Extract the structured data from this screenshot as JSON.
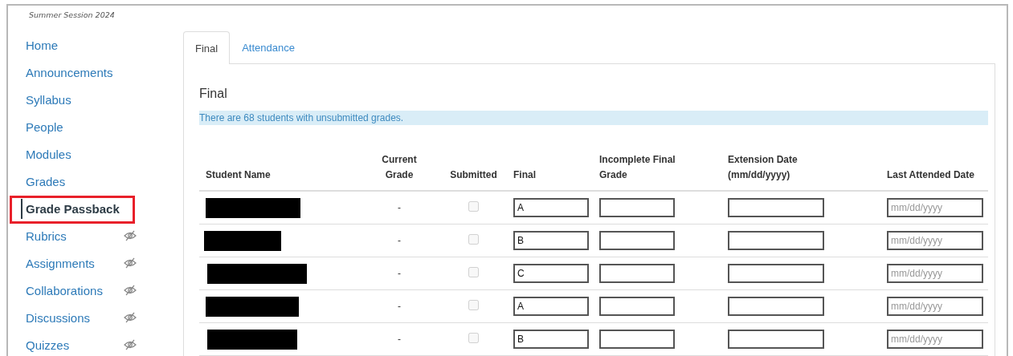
{
  "course": {
    "term": "Summer Session 2024"
  },
  "sidebar": {
    "items": [
      {
        "label": "Home",
        "selected": false,
        "hidden": false,
        "outlined": false
      },
      {
        "label": "Announcements",
        "selected": false,
        "hidden": false,
        "outlined": false
      },
      {
        "label": "Syllabus",
        "selected": false,
        "hidden": false,
        "outlined": false
      },
      {
        "label": "People",
        "selected": false,
        "hidden": false,
        "outlined": false
      },
      {
        "label": "Modules",
        "selected": false,
        "hidden": false,
        "outlined": false
      },
      {
        "label": "Grades",
        "selected": false,
        "hidden": false,
        "outlined": false
      },
      {
        "label": "Grade Passback",
        "selected": true,
        "hidden": false,
        "outlined": true
      },
      {
        "label": "Rubrics",
        "selected": false,
        "hidden": true,
        "outlined": false
      },
      {
        "label": "Assignments",
        "selected": false,
        "hidden": true,
        "outlined": false
      },
      {
        "label": "Collaborations",
        "selected": false,
        "hidden": true,
        "outlined": false
      },
      {
        "label": "Discussions",
        "selected": false,
        "hidden": true,
        "outlined": false
      },
      {
        "label": "Quizzes",
        "selected": false,
        "hidden": true,
        "outlined": false
      }
    ]
  },
  "tabs": [
    {
      "label": "Final",
      "selected": true
    },
    {
      "label": "Attendance",
      "selected": false
    }
  ],
  "panel": {
    "heading": "Final",
    "notice": "There are 68 students with unsubmitted grades."
  },
  "table": {
    "columns": [
      {
        "kind": "name",
        "label": "Student Name"
      },
      {
        "kind": "grade",
        "label": "Current Grade"
      },
      {
        "kind": "submitted",
        "label": "Submitted"
      },
      {
        "kind": "final",
        "label": "Final"
      },
      {
        "kind": "incomplete",
        "label": "Incomplete Final Grade"
      },
      {
        "kind": "extension",
        "label": "Extension Date (mm/dd/yyyy)"
      },
      {
        "kind": "attended",
        "label": "Last Attended Date"
      }
    ],
    "rows": [
      {
        "current_grade": "-",
        "submitted": false,
        "final": "A",
        "last_attended_placeholder": "mm/dd/yyyy"
      },
      {
        "current_grade": "-",
        "submitted": false,
        "final": "B",
        "last_attended_placeholder": "mm/dd/yyyy"
      },
      {
        "current_grade": "-",
        "submitted": false,
        "final": "C",
        "last_attended_placeholder": "mm/dd/yyyy"
      },
      {
        "current_grade": "-",
        "submitted": false,
        "final": "A",
        "last_attended_placeholder": "mm/dd/yyyy"
      },
      {
        "current_grade": "-",
        "submitted": false,
        "final": "B",
        "last_attended_placeholder": "mm/dd/yyyy"
      }
    ]
  }
}
